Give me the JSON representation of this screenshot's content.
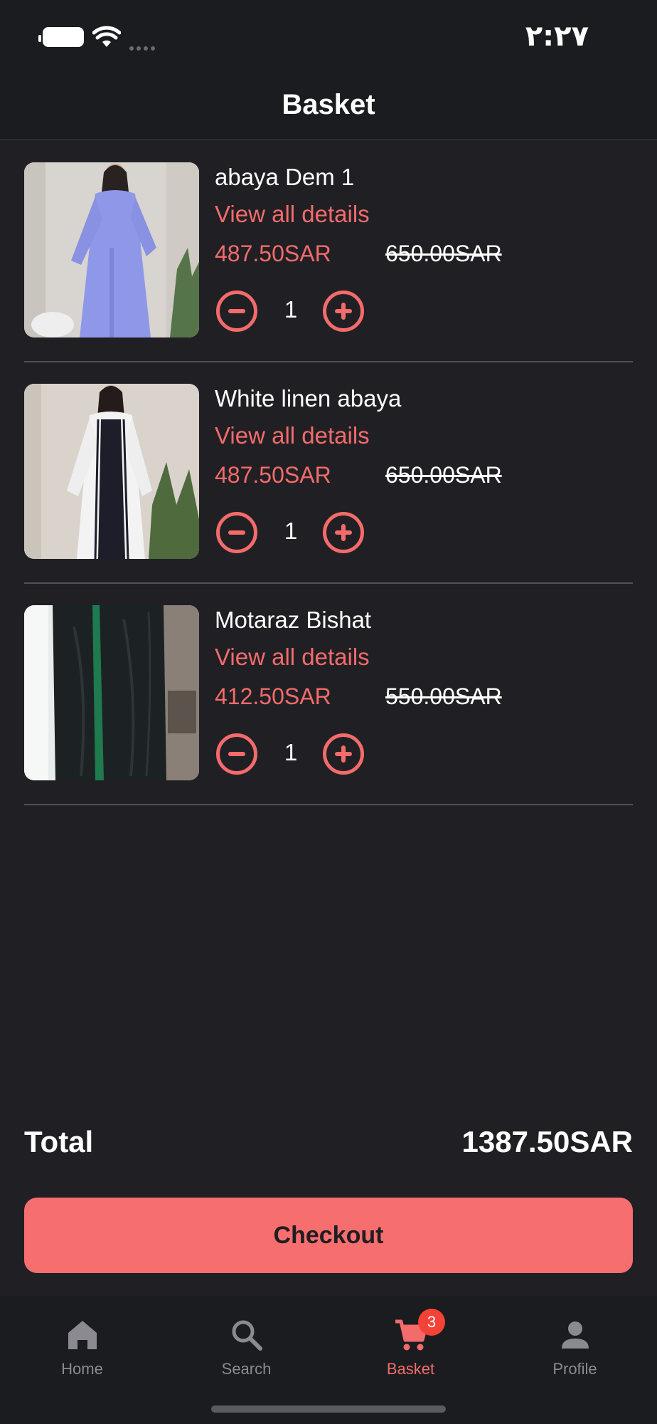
{
  "status_bar": {
    "time": "٢:٢٧"
  },
  "header": {
    "title": "Basket"
  },
  "basket": {
    "items": [
      {
        "name": "abaya Dem 1",
        "details_link": "View all details",
        "price": "487.50SAR",
        "old_price": "650.00SAR",
        "quantity": "1"
      },
      {
        "name": "White linen abaya",
        "details_link": "View all details",
        "price": "487.50SAR",
        "old_price": "650.00SAR",
        "quantity": "1"
      },
      {
        "name": "Motaraz Bishat",
        "details_link": "View all details",
        "price": "412.50SAR",
        "old_price": "550.00SAR",
        "quantity": "1"
      }
    ]
  },
  "summary": {
    "total_label": "Total",
    "total_value": "1387.50SAR"
  },
  "checkout": {
    "label": "Checkout"
  },
  "nav": {
    "items": [
      {
        "label": "Home",
        "icon": "home-icon"
      },
      {
        "label": "Search",
        "icon": "search-icon"
      },
      {
        "label": "Basket",
        "icon": "cart-icon",
        "badge": "3",
        "active": true
      },
      {
        "label": "Profile",
        "icon": "person-icon"
      }
    ]
  },
  "colors": {
    "accent": "#f36b6b",
    "checkout_bg": "#f76e6e",
    "background": "#202024",
    "badge": "#f44336"
  }
}
